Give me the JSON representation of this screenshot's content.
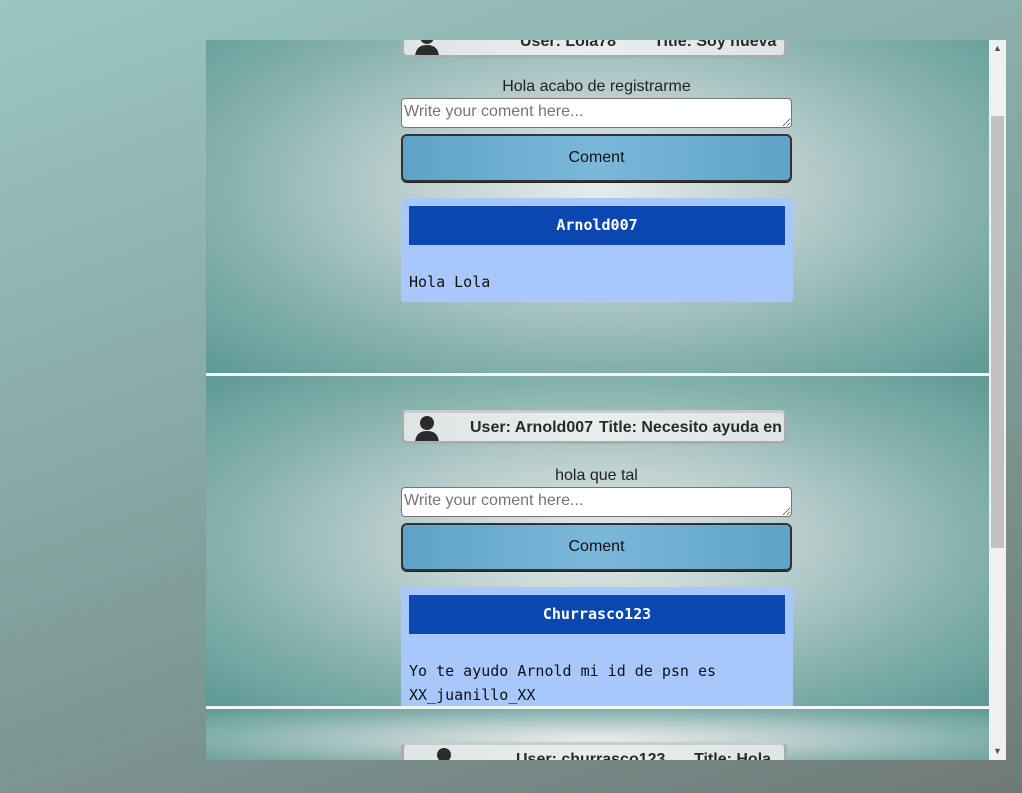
{
  "comment_placeholder": "Write your coment here...",
  "coment_button_label": "Coment",
  "user_prefix": "User: ",
  "title_prefix": "Title: ",
  "posts": [
    {
      "user": "Lola78",
      "title": "Soy nueva",
      "body": "Hola acabo de registrarme",
      "comments": [
        {
          "author": "Arnold007",
          "text": "Hola Lola"
        }
      ]
    },
    {
      "user": "Arnold007",
      "title": "Necesito ayuda en x",
      "body": "hola que tal",
      "comments": [
        {
          "author": "Churrasco123",
          "text": "Yo te ayudo Arnold mi id de psn es XX_juanillo_XX"
        }
      ]
    },
    {
      "user": "churrasco123",
      "title": "Hola",
      "body": "",
      "comments": []
    }
  ],
  "icons": {
    "avatar": "user-silhouette-icon",
    "scroll_up": "arrow-up-icon",
    "scroll_down": "arrow-down-icon"
  }
}
